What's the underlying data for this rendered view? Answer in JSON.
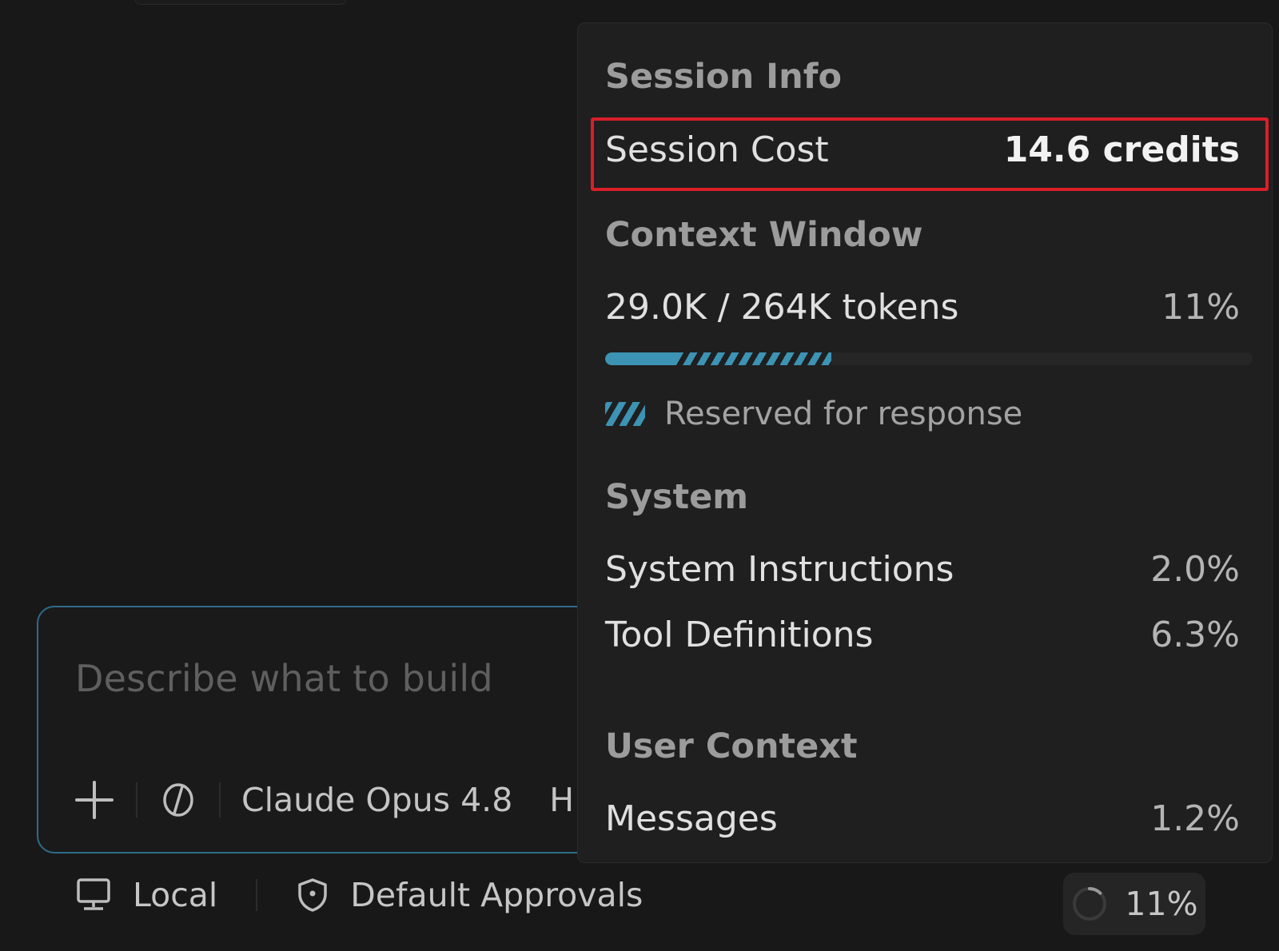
{
  "composer": {
    "placeholder": "Describe what to build",
    "model": "Claude Opus 4.8",
    "more_glyph": "H"
  },
  "statusbar": {
    "environment": "Local",
    "approvals": "Default Approvals",
    "usage_percent": "11%"
  },
  "popover": {
    "title": "Session Info",
    "session_cost": {
      "label": "Session Cost",
      "value": "14.6 credits"
    },
    "context_window": {
      "heading": "Context Window",
      "tokens": "29.0K / 264K tokens",
      "percent": "11%",
      "used_fraction": 0.11,
      "reserved_fraction": 0.24,
      "legend": "Reserved for response"
    },
    "system": {
      "heading": "System",
      "items": [
        {
          "label": "System Instructions",
          "value": "2.0%"
        },
        {
          "label": "Tool Definitions",
          "value": "6.3%"
        }
      ]
    },
    "user_context": {
      "heading": "User Context",
      "items": [
        {
          "label": "Messages",
          "value": "1.2%"
        }
      ]
    }
  },
  "colors": {
    "accent": "#3c93b4",
    "highlight": "#d91f2a",
    "popover_bg": "#1f1f1f",
    "page_bg": "#181818"
  }
}
